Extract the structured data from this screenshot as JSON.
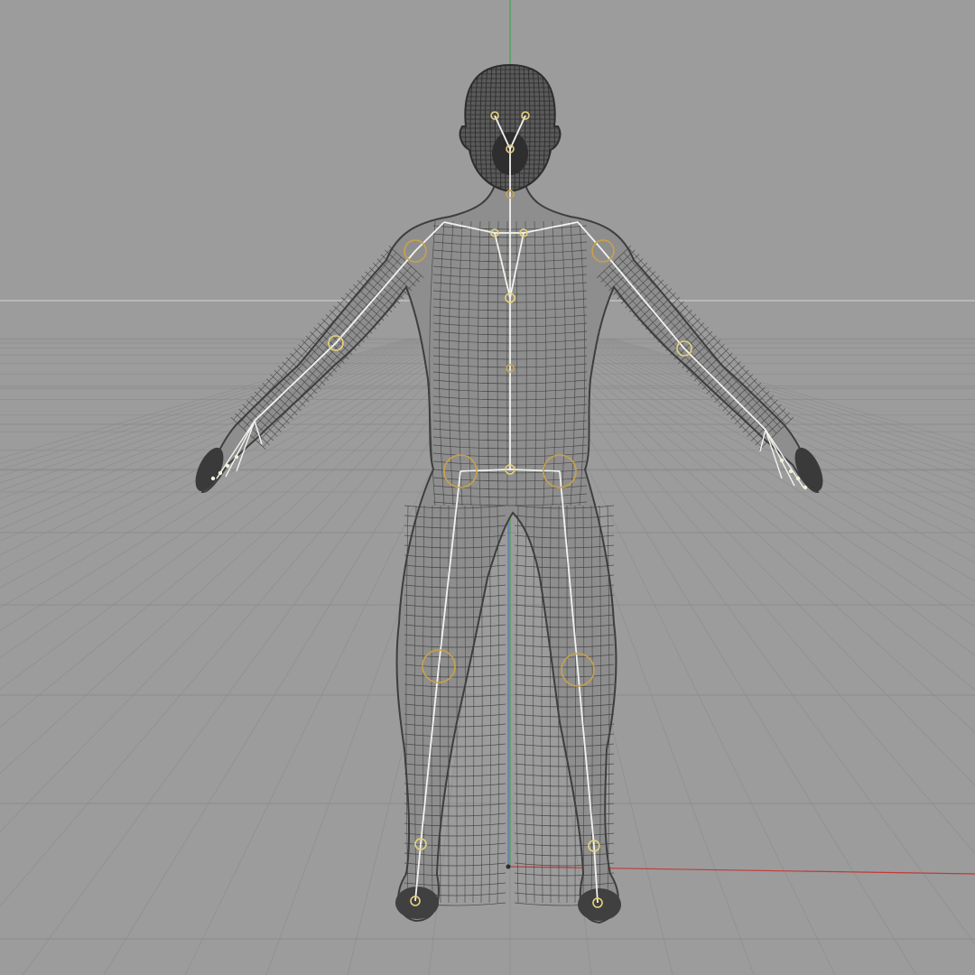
{
  "viewport": {
    "view": "front",
    "shading": "wireframe",
    "background_color": "#9c9c9c"
  },
  "grid": {
    "visible": true,
    "line_color": "#8a8a8a",
    "horizon_color": "#c8c8c8"
  },
  "axes": {
    "x_axis_color": "#c23a3a",
    "y_axis_color": "#3fa64a",
    "z_axis_color": "#5560d0",
    "origin_color": "#2b2b2b"
  },
  "model": {
    "type": "humanoid-mesh",
    "pose": "A-pose",
    "mesh_color": "#3e3e3e",
    "mesh_highlight_color": "#5a5a5a"
  },
  "rig": {
    "visible": true,
    "bone_color": "#f2f2ee",
    "joint_color": "#e6d27a",
    "joint_alt_color": "#c9a24a"
  }
}
